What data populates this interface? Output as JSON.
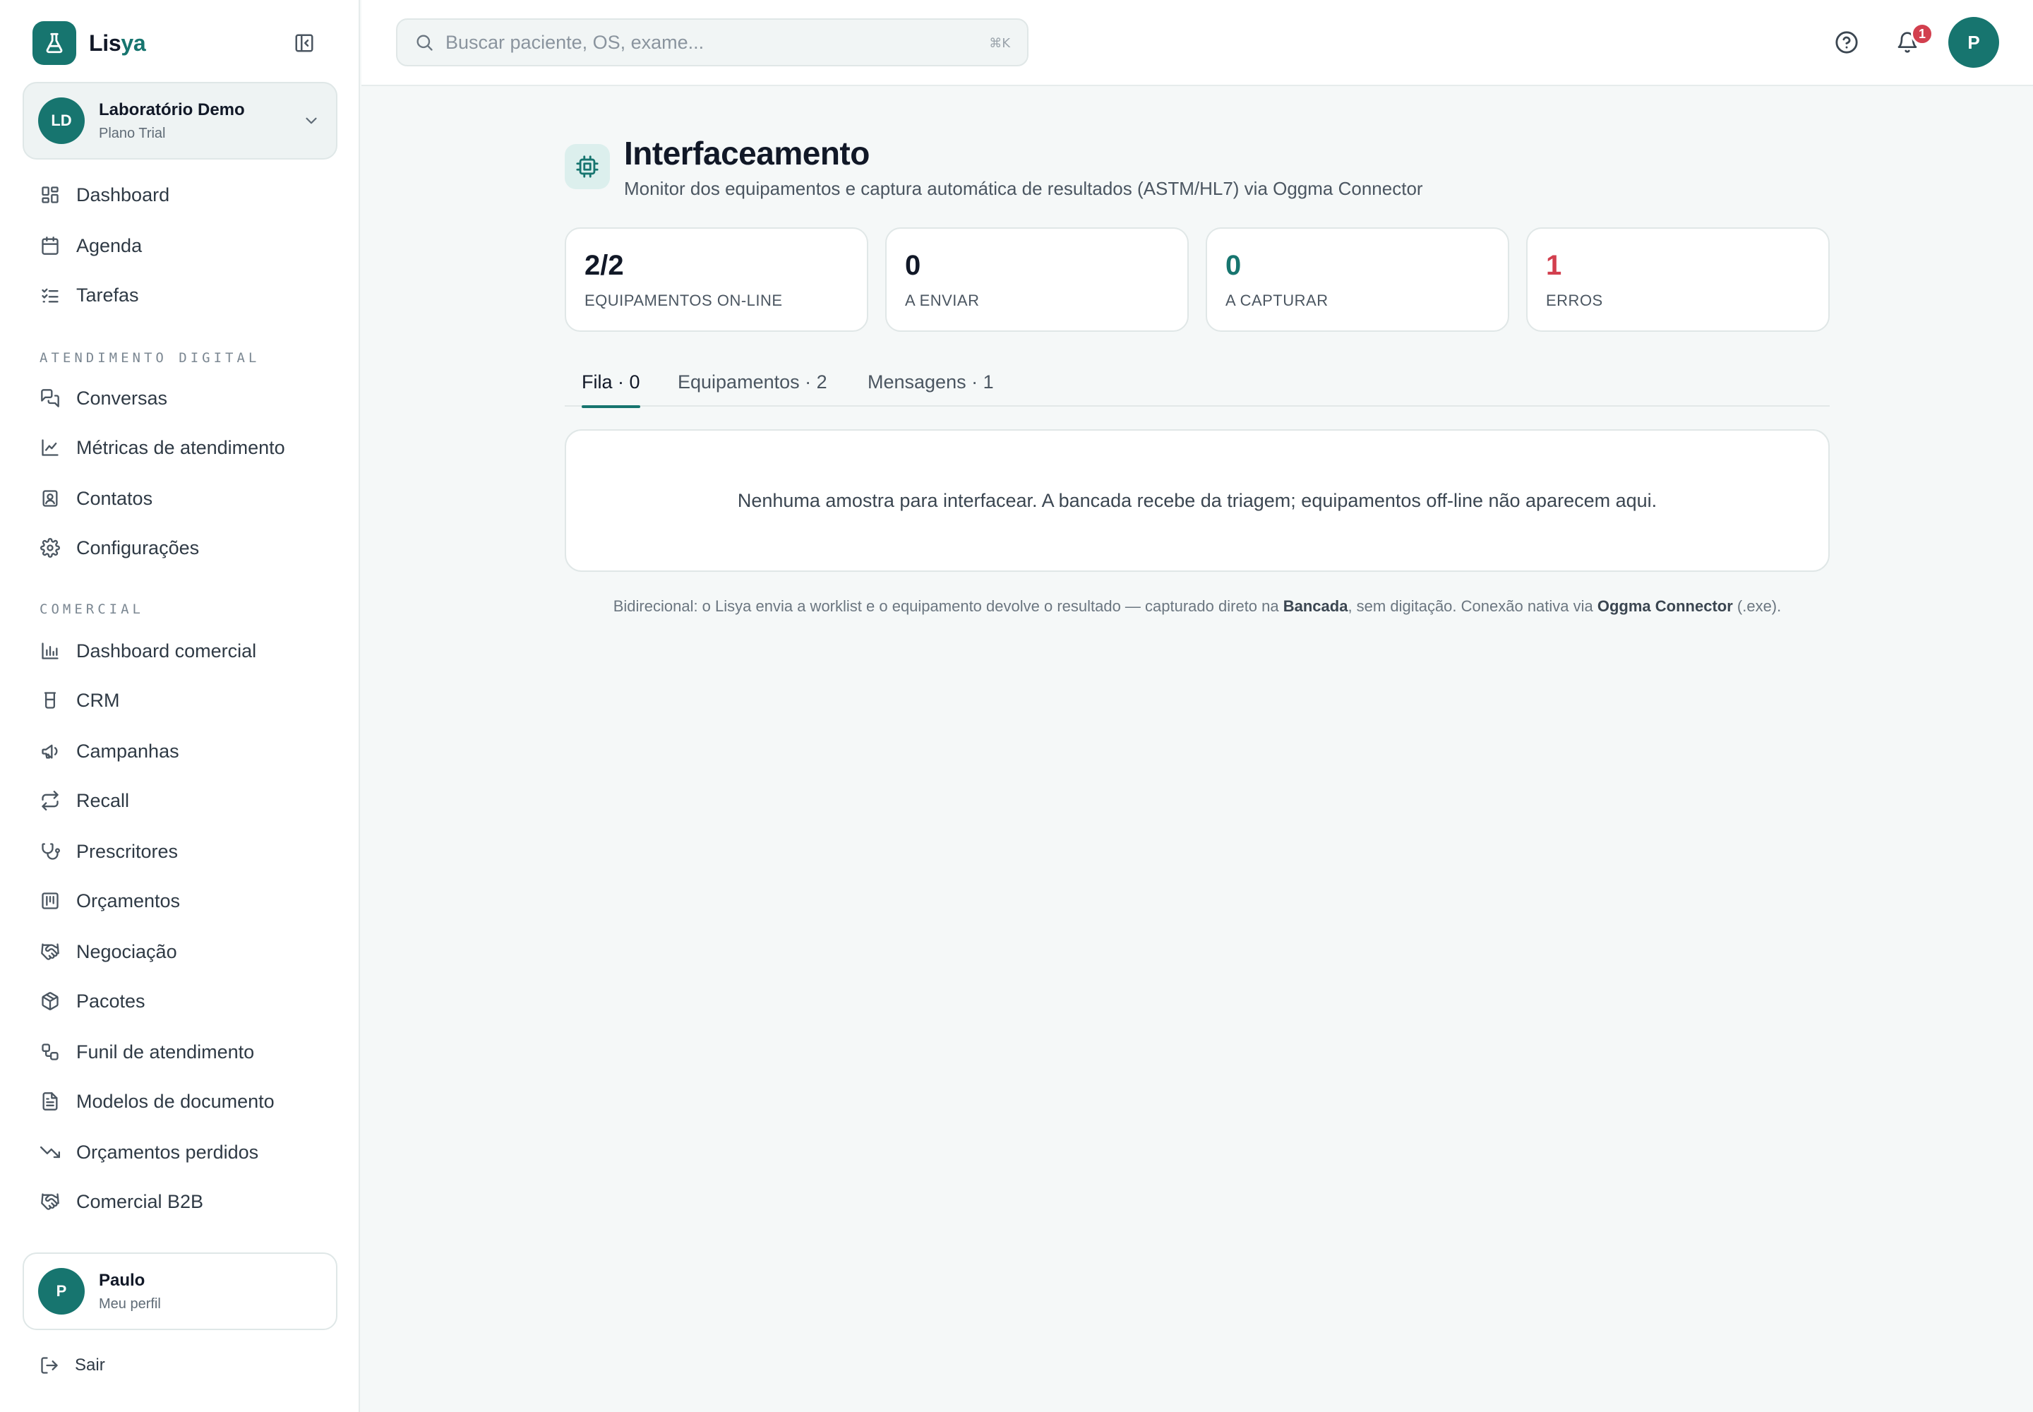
{
  "app": {
    "name_prefix": "Lis",
    "name_suffix": "ya"
  },
  "org": {
    "initials": "LD",
    "name": "Laboratório Demo",
    "plan": "Plano Trial"
  },
  "nav": {
    "main": [
      {
        "label": "Dashboard",
        "icon": "layout-grid-icon"
      },
      {
        "label": "Agenda",
        "icon": "calendar-icon"
      },
      {
        "label": "Tarefas",
        "icon": "list-checks-icon"
      }
    ],
    "sections": [
      {
        "title": "ATENDIMENTO DIGITAL",
        "items": [
          {
            "label": "Conversas",
            "icon": "messages-icon"
          },
          {
            "label": "Métricas de atendimento",
            "icon": "line-chart-icon"
          },
          {
            "label": "Contatos",
            "icon": "contact-icon"
          },
          {
            "label": "Configurações",
            "icon": "gear-icon"
          }
        ]
      },
      {
        "title": "COMERCIAL",
        "items": [
          {
            "label": "Dashboard comercial",
            "icon": "bar-chart-icon"
          },
          {
            "label": "CRM",
            "icon": "cup-icon"
          },
          {
            "label": "Campanhas",
            "icon": "megaphone-icon"
          },
          {
            "label": "Recall",
            "icon": "repeat-icon"
          },
          {
            "label": "Prescritores",
            "icon": "stethoscope-icon"
          },
          {
            "label": "Orçamentos",
            "icon": "receipt-icon"
          },
          {
            "label": "Negociação",
            "icon": "handshake-icon"
          },
          {
            "label": "Pacotes",
            "icon": "package-icon"
          },
          {
            "label": "Funil de atendimento",
            "icon": "workflow-icon"
          },
          {
            "label": "Modelos de documento",
            "icon": "file-text-icon"
          },
          {
            "label": "Orçamentos perdidos",
            "icon": "trending-down-icon"
          },
          {
            "label": "Comercial B2B",
            "icon": "handshake-icon"
          }
        ]
      }
    ]
  },
  "user": {
    "initial": "P",
    "name": "Paulo",
    "profile_link": "Meu perfil",
    "logout": "Sair"
  },
  "topbar": {
    "search_placeholder": "Buscar paciente, OS, exame...",
    "shortcut": "⌘K",
    "notification_count": "1",
    "avatar_initial": "P"
  },
  "page": {
    "title": "Interfaceamento",
    "subtitle": "Monitor dos equipamentos e captura automática de resultados (ASTM/HL7) via Oggma Connector"
  },
  "stats": [
    {
      "value": "2/2",
      "label": "EQUIPAMENTOS ON-LINE",
      "color": "#111827"
    },
    {
      "value": "0",
      "label": "A ENVIAR",
      "color": "#111827"
    },
    {
      "value": "0",
      "label": "A CAPTURAR",
      "color": "#17756f"
    },
    {
      "value": "1",
      "label": "ERROS",
      "color": "#d23f4e"
    }
  ],
  "tabs": [
    {
      "label": "Fila · 0",
      "active": true
    },
    {
      "label": "Equipamentos · 2",
      "active": false
    },
    {
      "label": "Mensagens · 1",
      "active": false
    }
  ],
  "empty_message": "Nenhuma amostra para interfacear. A bancada recebe da triagem; equipamentos off-line não aparecem aqui.",
  "footnote": {
    "part1": "Bidirecional: o Lisya envia a worklist e o equipamento devolve o resultado — capturado direto na ",
    "bold1": "Bancada",
    "part2": ", sem digitação. Conexão nativa via ",
    "bold2": "Oggma Connector",
    "part3": " (.exe)."
  },
  "colors": {
    "accent": "#17756f",
    "danger": "#d23f4e",
    "background": "#f5f8f8"
  }
}
